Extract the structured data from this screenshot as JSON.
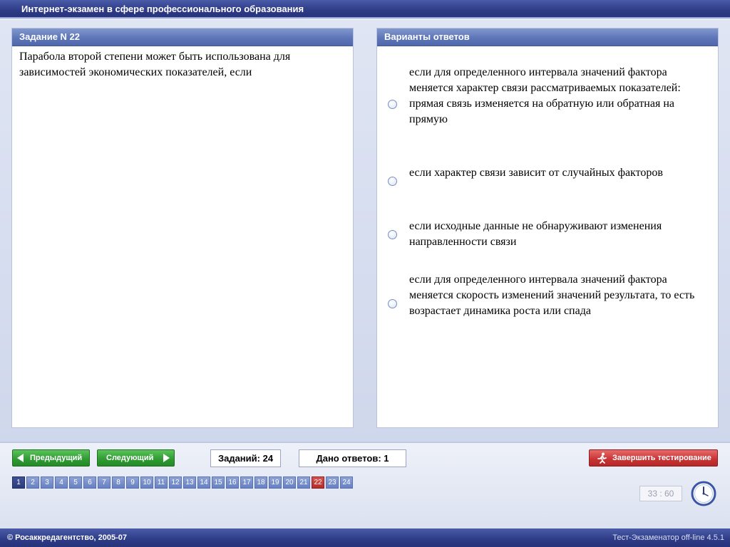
{
  "window": {
    "title": "Интернет-экзамен в сфере профессионального образования"
  },
  "question": {
    "header": "Задание N 22",
    "text": "Парабола второй степени может быть использована для зависимостей экономических показателей, если"
  },
  "answers": {
    "header": "Варианты ответов",
    "options": [
      "если для определенного интервала значений фактора меняется характер связи рассматриваемых показателей: прямая связь изменяется на обратную или обратная на прямую",
      "если характер связи зависит от случайных факторов",
      "если исходные данные не обнаруживают изменения направленности связи",
      "если для определенного интервала значений фактора меняется скорость  изменений значений результата, то есть возрастает динамика роста или спада"
    ]
  },
  "navigation": {
    "prev_label": "Предыдущий",
    "next_label": "Следующий",
    "total_label": "Заданий: 24",
    "answered_label": "Дано ответов: 1",
    "finish_label": "Завершить тестирование"
  },
  "pages": {
    "items": [
      "1",
      "2",
      "3",
      "4",
      "5",
      "6",
      "7",
      "8",
      "9",
      "10",
      "11",
      "12",
      "13",
      "14",
      "15",
      "16",
      "17",
      "18",
      "19",
      "20",
      "21",
      "22",
      "23",
      "24"
    ],
    "current": "22",
    "answered": [
      "1"
    ]
  },
  "timer": {
    "value": "33 : 60"
  },
  "footer": {
    "copyright": "© Росаккредагентство, 2005-07",
    "version": "Тест-Экзаменатор off-line 4.5.1"
  },
  "colors": {
    "title_bar": "#2e3b86",
    "panel_header": "#5d76b8",
    "green_button": "#2e9a31",
    "red_button": "#c73333",
    "current_page": "#b32d2a"
  },
  "icons": {
    "finish": "running-man-icon",
    "timer": "clock-icon"
  }
}
